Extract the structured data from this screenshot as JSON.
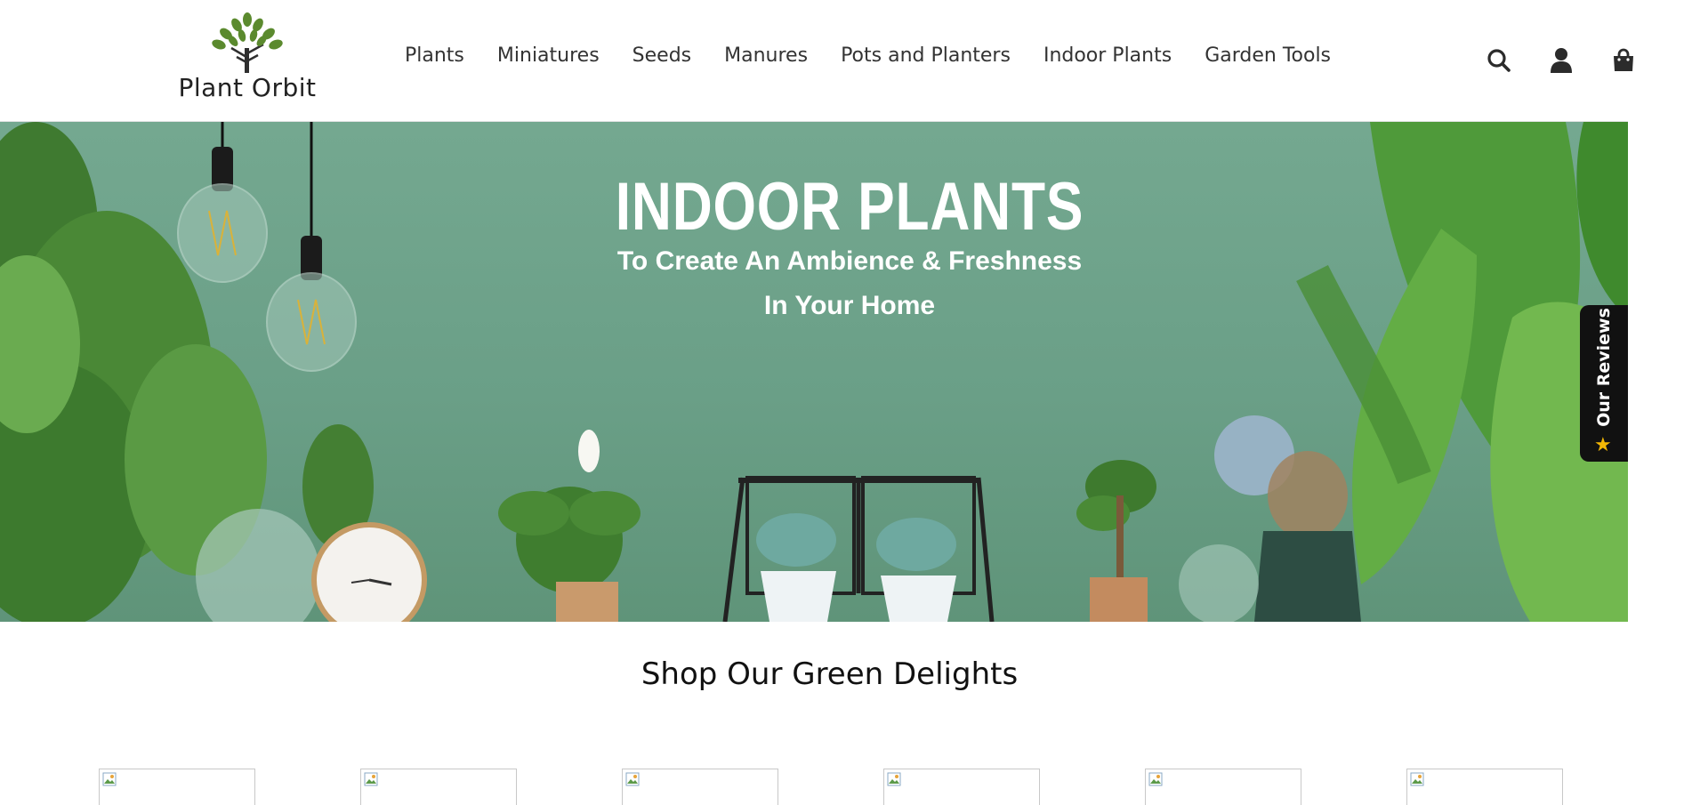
{
  "brand": {
    "name": "Plant Orbit"
  },
  "nav": {
    "items": [
      {
        "label": "Plants"
      },
      {
        "label": "Miniatures"
      },
      {
        "label": "Seeds"
      },
      {
        "label": "Manures"
      },
      {
        "label": "Pots and Planters"
      },
      {
        "label": "Indoor Plants"
      },
      {
        "label": "Garden Tools"
      }
    ]
  },
  "header_icons": [
    "search-icon",
    "account-icon",
    "cart-bag-icon"
  ],
  "hero": {
    "title": "INDOOR PLANTS",
    "subtitle_line1": "To Create An Ambience & Freshness",
    "subtitle_line2": "In Your Home"
  },
  "reviews_tab": {
    "label": "Our Reviews",
    "icon": "star-icon"
  },
  "section": {
    "title": "Shop Our Green Delights"
  },
  "colors": {
    "hero_bg": "#6a9f87",
    "reviews_bg": "#111111",
    "star": "#f2b705",
    "text": "#333333"
  }
}
